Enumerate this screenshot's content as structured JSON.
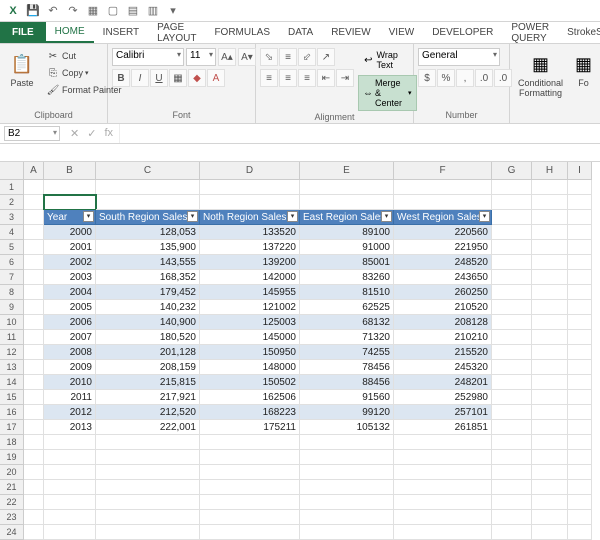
{
  "qat": {
    "app": "xl"
  },
  "tabs": {
    "file": "FILE",
    "home": "HOME",
    "insert": "INSERT",
    "pagelayout": "PAGE LAYOUT",
    "formulas": "FORMULAS",
    "data": "DATA",
    "review": "REVIEW",
    "view": "VIEW",
    "developer": "DEVELOPER",
    "powerquery": "POWER QUERY",
    "strokescribe": "StrokeScribe"
  },
  "ribbon": {
    "clipboard": {
      "paste": "Paste",
      "cut": "Cut",
      "copy": "Copy",
      "painter": "Format Painter",
      "label": "Clipboard"
    },
    "font": {
      "name": "Calibri",
      "size": "11",
      "label": "Font"
    },
    "alignment": {
      "wrap": "Wrap Text",
      "merge": "Merge & Center",
      "label": "Alignment"
    },
    "number": {
      "format": "General",
      "label": "Number"
    },
    "styles": {
      "cond": "Conditional",
      "cond2": "Formatting",
      "fmt": "Fo"
    }
  },
  "fbar": {
    "ref": "B2",
    "fx": "fx"
  },
  "cols": [
    "A",
    "B",
    "C",
    "D",
    "E",
    "F",
    "G",
    "H",
    "I"
  ],
  "headers": {
    "year": "Year",
    "south": "South Region Sales",
    "north": "Noth Region Sales",
    "east": "East Region Sales",
    "west": "West Region Sales"
  },
  "chart_data": {
    "type": "table",
    "columns": [
      "Year",
      "South Region Sales",
      "Noth Region Sales",
      "East Region Sales",
      "West Region Sales"
    ],
    "rows": [
      {
        "year": 2000,
        "south": "128,053",
        "north": "133520",
        "east": "89100",
        "west": "220560"
      },
      {
        "year": 2001,
        "south": "135,900",
        "north": "137220",
        "east": "91000",
        "west": "221950"
      },
      {
        "year": 2002,
        "south": "143,555",
        "north": "139200",
        "east": "85001",
        "west": "248520"
      },
      {
        "year": 2003,
        "south": "168,352",
        "north": "142000",
        "east": "83260",
        "west": "243650"
      },
      {
        "year": 2004,
        "south": "179,452",
        "north": "145955",
        "east": "81510",
        "west": "260250"
      },
      {
        "year": 2005,
        "south": "140,232",
        "north": "121002",
        "east": "62525",
        "west": "210520"
      },
      {
        "year": 2006,
        "south": "140,900",
        "north": "125003",
        "east": "68132",
        "west": "208128"
      },
      {
        "year": 2007,
        "south": "180,520",
        "north": "145000",
        "east": "71320",
        "west": "210210"
      },
      {
        "year": 2008,
        "south": "201,128",
        "north": "150950",
        "east": "74255",
        "west": "215520"
      },
      {
        "year": 2009,
        "south": "208,159",
        "north": "148000",
        "east": "78456",
        "west": "245320"
      },
      {
        "year": 2010,
        "south": "215,815",
        "north": "150502",
        "east": "88456",
        "west": "248201"
      },
      {
        "year": 2011,
        "south": "217,921",
        "north": "162506",
        "east": "91560",
        "west": "252980"
      },
      {
        "year": 2012,
        "south": "212,520",
        "north": "168223",
        "east": "99120",
        "west": "257101"
      },
      {
        "year": 2013,
        "south": "222,001",
        "north": "175211",
        "east": "105132",
        "west": "261851"
      }
    ]
  }
}
